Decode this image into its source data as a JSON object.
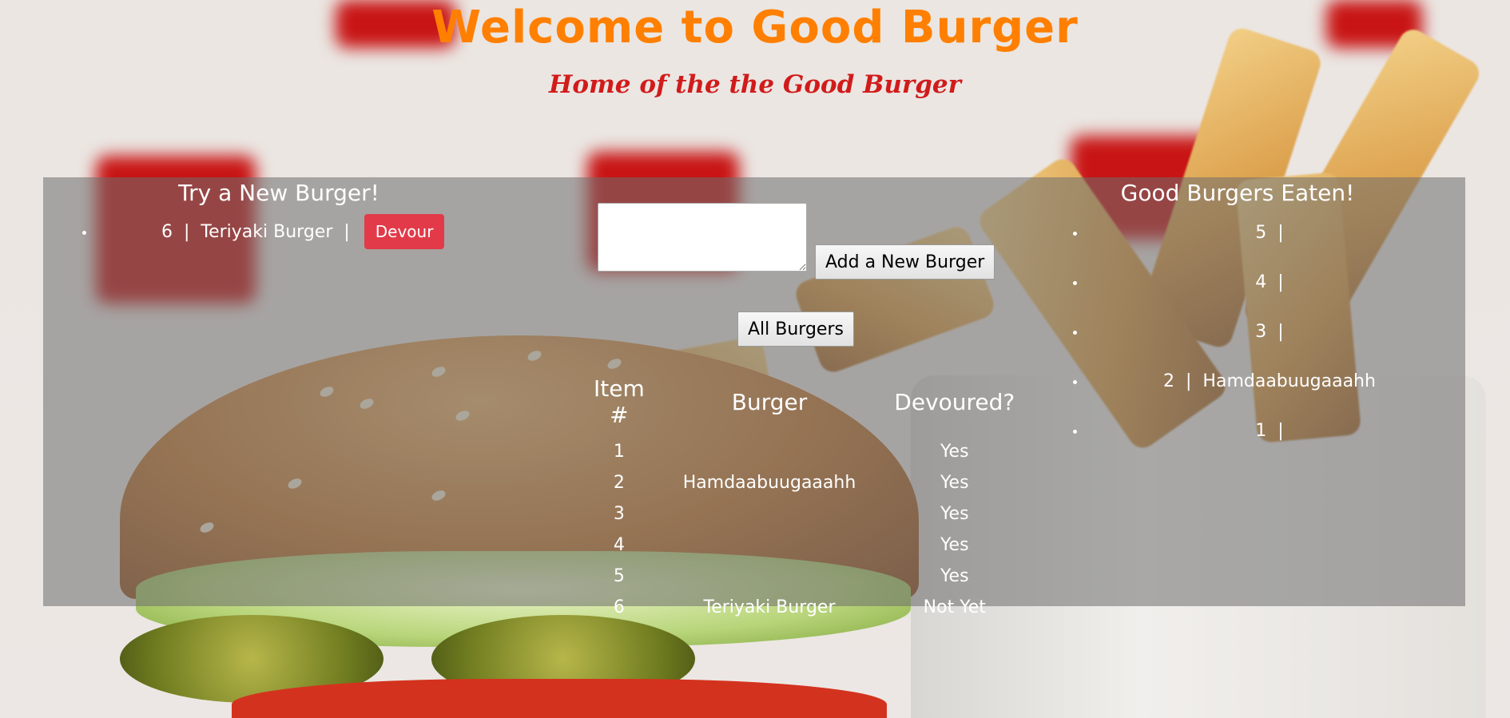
{
  "header": {
    "title": "Welcome to Good Burger",
    "subtitle": "Home of the the Good Burger"
  },
  "new_burgers": {
    "heading": "Try a New Burger!",
    "items": [
      {
        "text": "6  |  Teriyaki Burger  |",
        "button_label": "Devour"
      }
    ]
  },
  "form": {
    "input_value": "",
    "add_button_label": "Add a New Burger",
    "all_button_label": "All Burgers"
  },
  "table": {
    "headers": [
      "Item #",
      "Burger",
      "Devoured?"
    ],
    "rows": [
      {
        "id": "1",
        "name": "",
        "devoured": "Yes"
      },
      {
        "id": "2",
        "name": "Hamdaabuugaaahh",
        "devoured": "Yes"
      },
      {
        "id": "3",
        "name": "",
        "devoured": "Yes"
      },
      {
        "id": "4",
        "name": "",
        "devoured": "Yes"
      },
      {
        "id": "5",
        "name": "",
        "devoured": "Yes"
      },
      {
        "id": "6",
        "name": "Teriyaki Burger",
        "devoured": "Not Yet"
      }
    ]
  },
  "eaten": {
    "heading": "Good Burgers Eaten!",
    "items": [
      {
        "text": "5  |"
      },
      {
        "text": "4  |"
      },
      {
        "text": "3  |"
      },
      {
        "text": "2  |  Hamdaabuugaaahh"
      },
      {
        "text": "1  |"
      }
    ]
  },
  "colors": {
    "title": "#ff7f00",
    "subtitle": "#d11b1b",
    "devour_button": "#e23a49"
  }
}
